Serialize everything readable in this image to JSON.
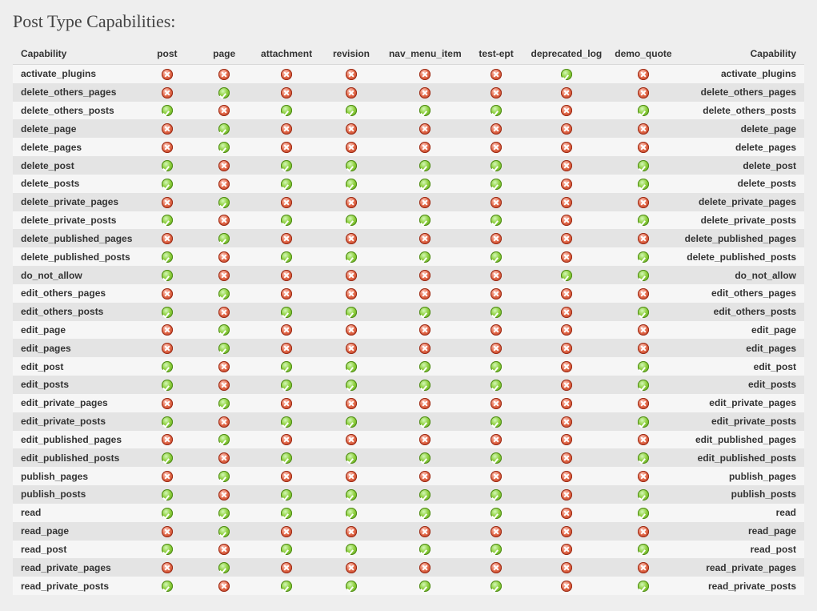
{
  "title": "Post Type Capabilities:",
  "columns": [
    "Capability",
    "post",
    "page",
    "attachment",
    "revision",
    "nav_menu_item",
    "test-ept",
    "deprecated_log",
    "demo_quote",
    "Capability"
  ],
  "rows": [
    {
      "name": "activate_plugins",
      "v": [
        0,
        0,
        0,
        0,
        0,
        0,
        1,
        0
      ]
    },
    {
      "name": "delete_others_pages",
      "v": [
        0,
        1,
        0,
        0,
        0,
        0,
        0,
        0
      ]
    },
    {
      "name": "delete_others_posts",
      "v": [
        1,
        0,
        1,
        1,
        1,
        1,
        0,
        1
      ]
    },
    {
      "name": "delete_page",
      "v": [
        0,
        1,
        0,
        0,
        0,
        0,
        0,
        0
      ]
    },
    {
      "name": "delete_pages",
      "v": [
        0,
        1,
        0,
        0,
        0,
        0,
        0,
        0
      ]
    },
    {
      "name": "delete_post",
      "v": [
        1,
        0,
        1,
        1,
        1,
        1,
        0,
        1
      ]
    },
    {
      "name": "delete_posts",
      "v": [
        1,
        0,
        1,
        1,
        1,
        1,
        0,
        1
      ]
    },
    {
      "name": "delete_private_pages",
      "v": [
        0,
        1,
        0,
        0,
        0,
        0,
        0,
        0
      ]
    },
    {
      "name": "delete_private_posts",
      "v": [
        1,
        0,
        1,
        1,
        1,
        1,
        0,
        1
      ]
    },
    {
      "name": "delete_published_pages",
      "v": [
        0,
        1,
        0,
        0,
        0,
        0,
        0,
        0
      ]
    },
    {
      "name": "delete_published_posts",
      "v": [
        1,
        0,
        1,
        1,
        1,
        1,
        0,
        1
      ]
    },
    {
      "name": "do_not_allow",
      "v": [
        1,
        0,
        0,
        0,
        0,
        0,
        1,
        1
      ]
    },
    {
      "name": "edit_others_pages",
      "v": [
        0,
        1,
        0,
        0,
        0,
        0,
        0,
        0
      ]
    },
    {
      "name": "edit_others_posts",
      "v": [
        1,
        0,
        1,
        1,
        1,
        1,
        0,
        1
      ]
    },
    {
      "name": "edit_page",
      "v": [
        0,
        1,
        0,
        0,
        0,
        0,
        0,
        0
      ]
    },
    {
      "name": "edit_pages",
      "v": [
        0,
        1,
        0,
        0,
        0,
        0,
        0,
        0
      ]
    },
    {
      "name": "edit_post",
      "v": [
        1,
        0,
        1,
        1,
        1,
        1,
        0,
        1
      ]
    },
    {
      "name": "edit_posts",
      "v": [
        1,
        0,
        1,
        1,
        1,
        1,
        0,
        1
      ]
    },
    {
      "name": "edit_private_pages",
      "v": [
        0,
        1,
        0,
        0,
        0,
        0,
        0,
        0
      ]
    },
    {
      "name": "edit_private_posts",
      "v": [
        1,
        0,
        1,
        1,
        1,
        1,
        0,
        1
      ]
    },
    {
      "name": "edit_published_pages",
      "v": [
        0,
        1,
        0,
        0,
        0,
        0,
        0,
        0
      ]
    },
    {
      "name": "edit_published_posts",
      "v": [
        1,
        0,
        1,
        1,
        1,
        1,
        0,
        1
      ]
    },
    {
      "name": "publish_pages",
      "v": [
        0,
        1,
        0,
        0,
        0,
        0,
        0,
        0
      ]
    },
    {
      "name": "publish_posts",
      "v": [
        1,
        0,
        1,
        1,
        1,
        1,
        0,
        1
      ]
    },
    {
      "name": "read",
      "v": [
        1,
        1,
        1,
        1,
        1,
        1,
        0,
        1
      ]
    },
    {
      "name": "read_page",
      "v": [
        0,
        1,
        0,
        0,
        0,
        0,
        0,
        0
      ]
    },
    {
      "name": "read_post",
      "v": [
        1,
        0,
        1,
        1,
        1,
        1,
        0,
        1
      ]
    },
    {
      "name": "read_private_pages",
      "v": [
        0,
        1,
        0,
        0,
        0,
        0,
        0,
        0
      ]
    },
    {
      "name": "read_private_posts",
      "v": [
        1,
        0,
        1,
        1,
        1,
        1,
        0,
        1
      ]
    }
  ]
}
